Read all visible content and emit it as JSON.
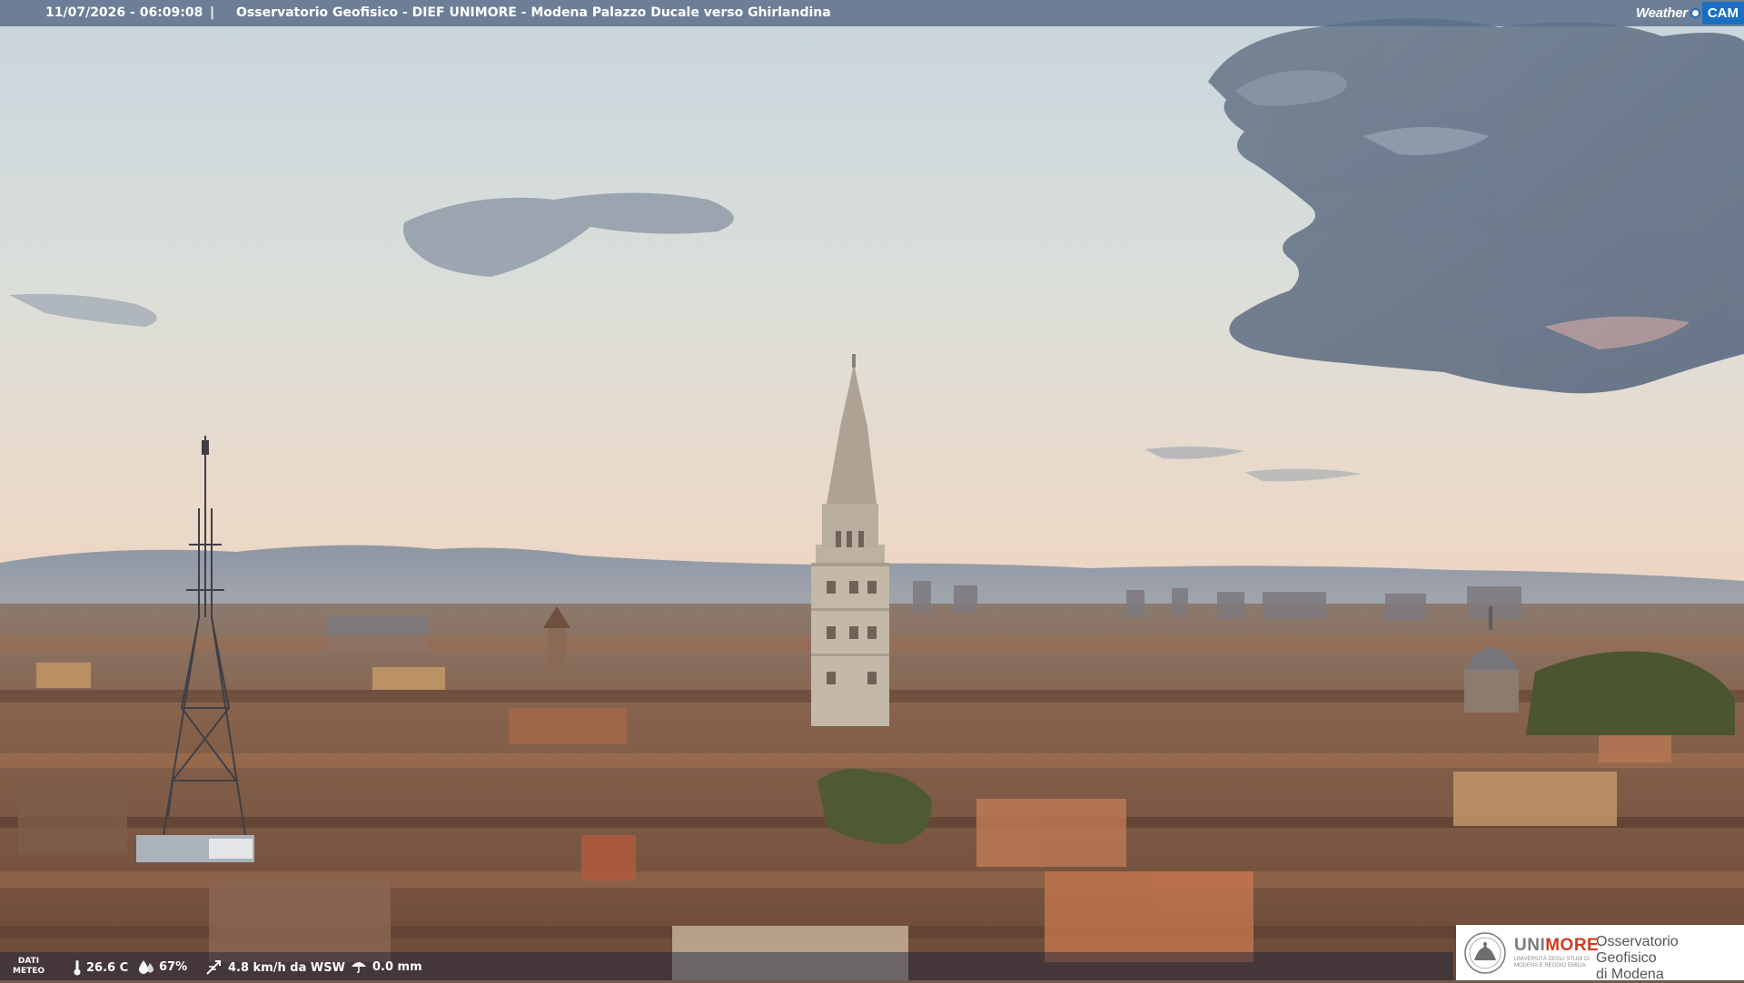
{
  "header": {
    "datetime": "11/07/2026 - 06:09:08",
    "separator": "|",
    "title": "Osservatorio Geofisico - DIEF UNIMORE - Modena Palazzo Ducale verso Ghirlandina",
    "logo_weather": "Weather",
    "logo_cam": "CAM"
  },
  "weather_bar": {
    "label_line1": "DATI",
    "label_line2": "METEO",
    "temperature": "26.6 C",
    "humidity": "67%",
    "wind": "4.8 km/h da WSW",
    "rain": "0.0 mm",
    "icons": [
      "thermometer-icon",
      "humidity-drop-icon",
      "wind-icon",
      "rain-icon"
    ]
  },
  "branding": {
    "uni_prefix": "UNI",
    "uni_suffix": "MORE",
    "uni_subtitle": "UNIVERSITÀ DEGLI STUDI DI MODENA E REGGIO EMILIA",
    "observatory_line1": "Osservatorio Geofisico",
    "observatory_line2": "di Modena"
  },
  "colors": {
    "header_bar": "#5c708a",
    "cam_badge": "#1a6fc2",
    "unimore_red": "#d03c1f"
  }
}
